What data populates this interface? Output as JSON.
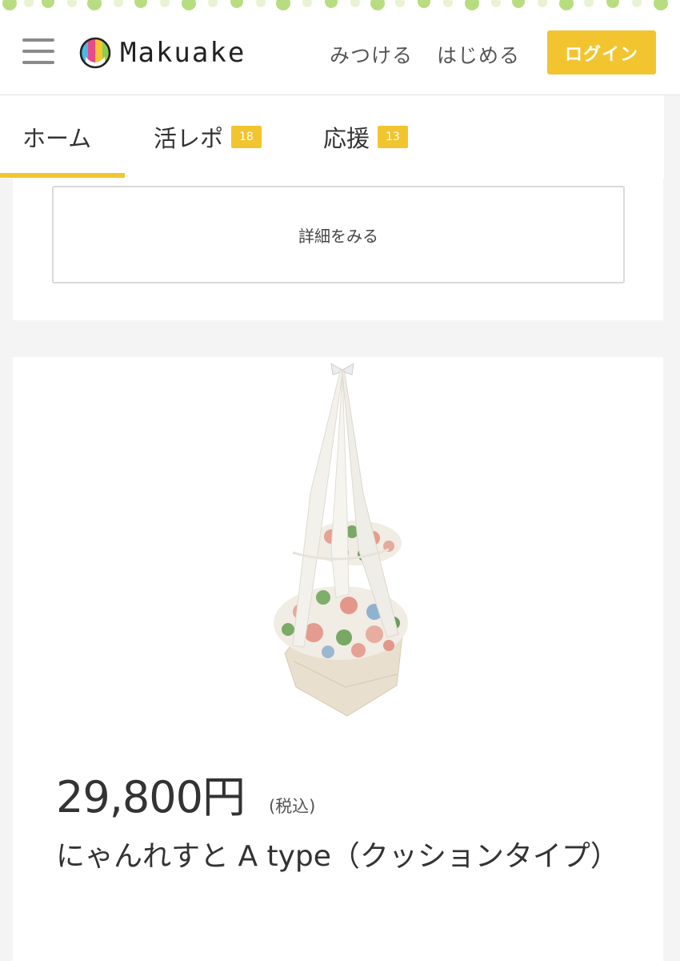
{
  "header": {
    "logo_text": "Makuake",
    "nav": [
      "みつける",
      "はじめる"
    ],
    "login_label": "ログイン"
  },
  "tabs": [
    {
      "label": "ホーム",
      "badge": null,
      "active": true
    },
    {
      "label": "活レポ",
      "badge": "18",
      "active": false
    },
    {
      "label": "応援",
      "badge": "13",
      "active": false
    }
  ],
  "detail_button": "詳細をみる",
  "product": {
    "price": "29,800円",
    "tax_note": "(税込)",
    "title": "にゃんれすと A type（クッションタイプ）"
  },
  "colors": {
    "accent": "#f2c530",
    "leaf": "#a8d86a"
  }
}
